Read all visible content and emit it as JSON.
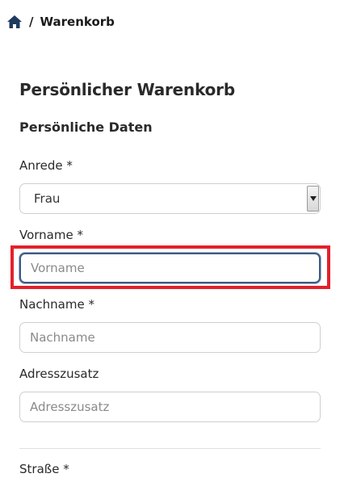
{
  "breadcrumb": {
    "home_icon": "home-icon",
    "separator": "/",
    "current": "Warenkorb"
  },
  "page": {
    "title": "Persönlicher Warenkorb",
    "section_title": "Persönliche Daten"
  },
  "form": {
    "anrede": {
      "label": "Anrede *",
      "selected": "Frau"
    },
    "vorname": {
      "label": "Vorname *",
      "placeholder": "Vorname",
      "value": ""
    },
    "nachname": {
      "label": "Nachname *",
      "placeholder": "Nachname",
      "value": ""
    },
    "adresszusatz": {
      "label": "Adresszusatz",
      "placeholder": "Adresszusatz",
      "value": ""
    },
    "strasse": {
      "label": "Straße *"
    }
  },
  "colors": {
    "highlight": "#e3202c",
    "focus_border": "#3d5a80",
    "home_icon": "#1f3a5f"
  }
}
